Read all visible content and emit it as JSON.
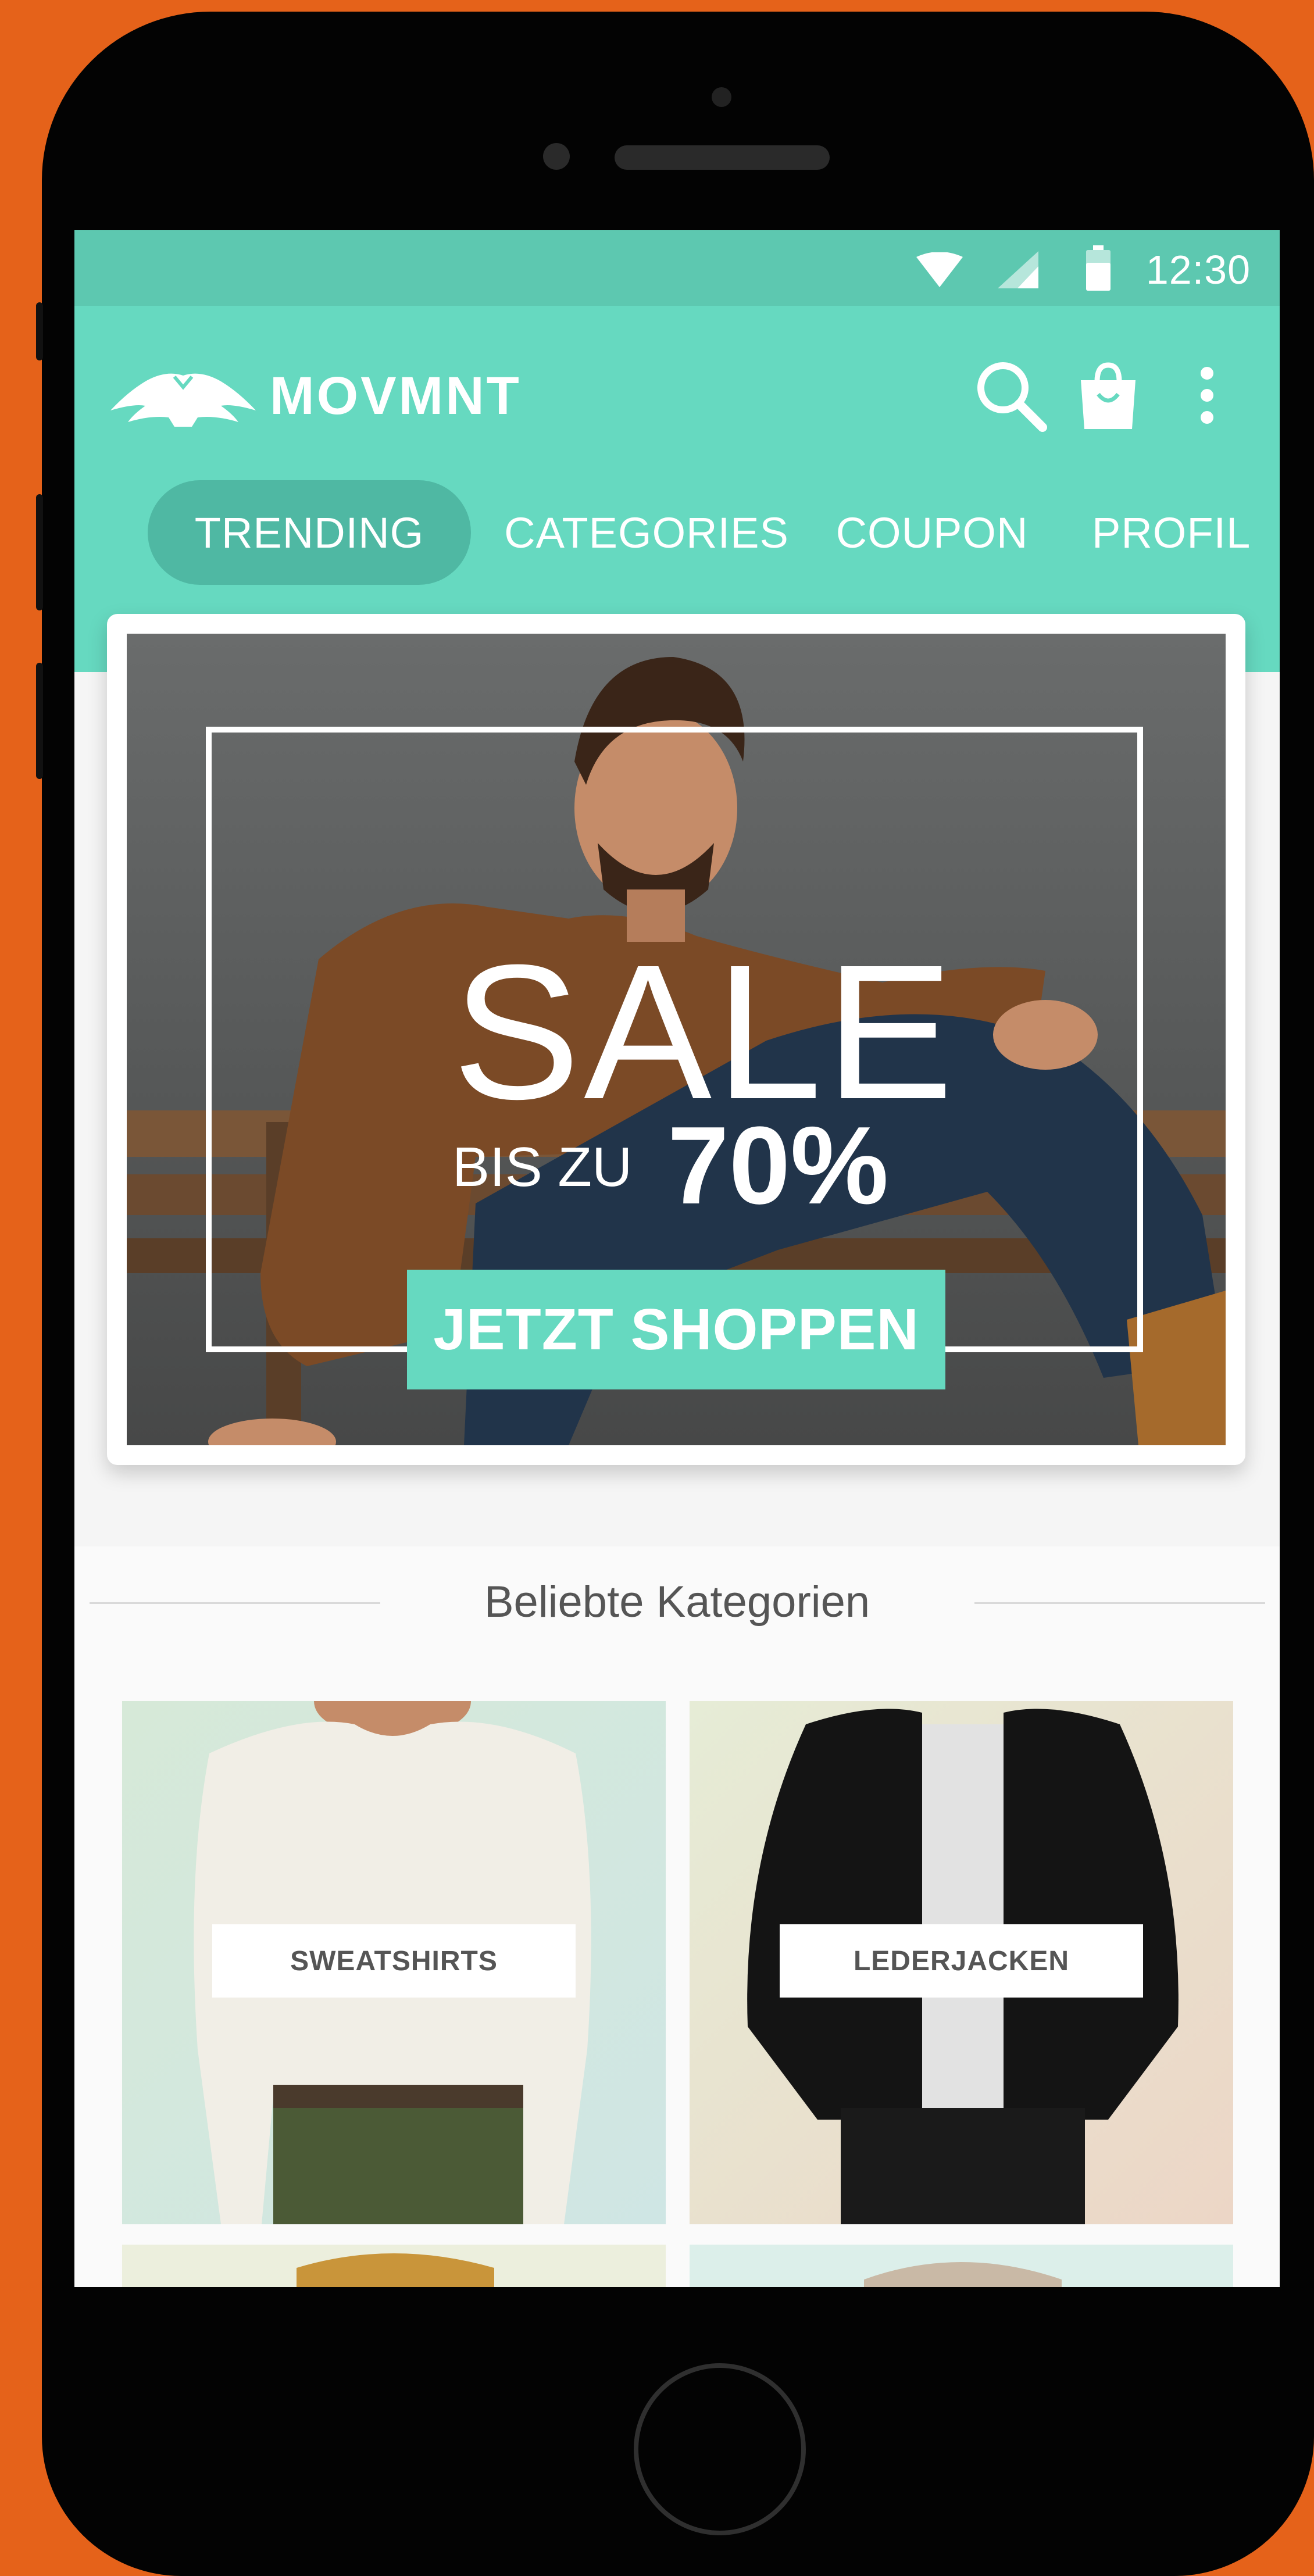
{
  "status_bar": {
    "time": "12:30"
  },
  "app": {
    "name": "MOVMNT"
  },
  "tabs": [
    {
      "label": "TRENDING"
    },
    {
      "label": "CATEGORIES"
    },
    {
      "label": "COUPON"
    },
    {
      "label": "PROFIL"
    }
  ],
  "banner": {
    "headline": "SALE",
    "subline_prefix": "BIS ZU",
    "discount": "70%",
    "cta_label": "JETZT SHOPPEN"
  },
  "section": {
    "title": "Beliebte Kategorien"
  },
  "categories": [
    {
      "label": "SWEATSHIRTS"
    },
    {
      "label": "LEDERJACKEN"
    }
  ],
  "colors": {
    "accent": "#66D9C0",
    "accent_dark": "#4FB8A3",
    "status_bar": "#5DC8B0",
    "device_background": "#E5621A"
  },
  "icons": [
    "wifi-icon",
    "signal-icon",
    "battery-icon",
    "search-icon",
    "shopping-bag-icon",
    "more-vert-icon",
    "logo-wings-icon"
  ]
}
